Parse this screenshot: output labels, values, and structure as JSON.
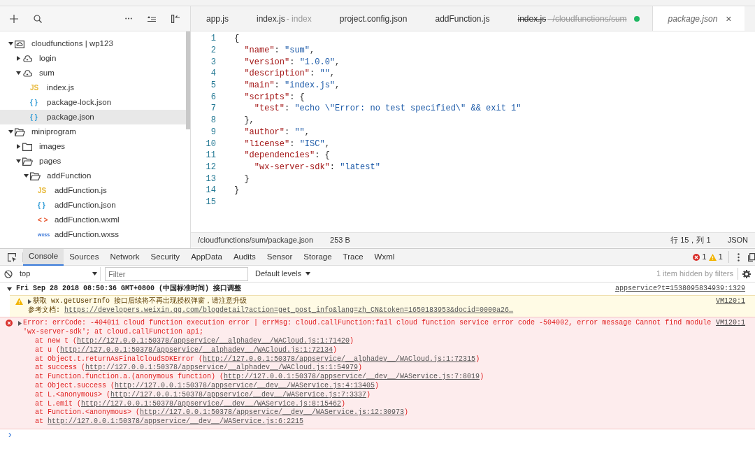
{
  "file_tree": [
    {
      "name": "cloudfunctions | wp123",
      "kind": "folder-cloud",
      "expanded": true,
      "selected": false,
      "children": [
        {
          "name": "login",
          "kind": "cloud",
          "expanded": false,
          "selected": false
        },
        {
          "name": "sum",
          "kind": "cloud",
          "expanded": true,
          "selected": false,
          "children": [
            {
              "name": "index.js",
              "kind": "js",
              "badge": "JS",
              "selected": false
            },
            {
              "name": "package-lock.json",
              "kind": "json",
              "badge": "{ }",
              "selected": false
            },
            {
              "name": "package.json",
              "kind": "json",
              "badge": "{ }",
              "selected": true
            }
          ]
        }
      ]
    },
    {
      "name": "miniprogram",
      "kind": "folder",
      "expanded": true,
      "selected": false,
      "children": [
        {
          "name": "images",
          "kind": "folder",
          "expanded": false,
          "selected": false
        },
        {
          "name": "pages",
          "kind": "folder",
          "expanded": true,
          "selected": false,
          "children": [
            {
              "name": "addFunction",
              "kind": "folder",
              "expanded": true,
              "selected": false,
              "children": [
                {
                  "name": "addFunction.js",
                  "kind": "js",
                  "badge": "JS",
                  "selected": false
                },
                {
                  "name": "addFunction.json",
                  "kind": "json",
                  "badge": "{ }",
                  "selected": false
                },
                {
                  "name": "addFunction.wxml",
                  "kind": "wxml",
                  "badge": "< >",
                  "selected": false
                },
                {
                  "name": "addFunction.wxss",
                  "kind": "wxss",
                  "badge": "wxss",
                  "selected": false
                }
              ]
            }
          ]
        }
      ]
    }
  ],
  "editor_tabs": [
    {
      "name": "app.js",
      "selected": false,
      "deleted": false,
      "modified": false,
      "preview": false
    },
    {
      "name": "index.js",
      "detail": " - index",
      "selected": false,
      "deleted": false,
      "modified": false,
      "preview": false
    },
    {
      "name": "project.config.json",
      "selected": false,
      "deleted": false,
      "modified": false,
      "preview": false
    },
    {
      "name": "addFunction.js",
      "selected": false,
      "deleted": false,
      "modified": false,
      "preview": false
    },
    {
      "name": "index.js",
      "detail": " - /cloudfunctions/sum",
      "selected": false,
      "deleted": true,
      "modified": true,
      "preview": false
    },
    {
      "name": "package.json",
      "selected": true,
      "deleted": false,
      "modified": false,
      "preview": true,
      "close": "×"
    }
  ],
  "code_lines": [
    {
      "number": "1",
      "tokens": [
        {
          "kind": "punct",
          "text": "{"
        }
      ]
    },
    {
      "number": "2",
      "tokens": [
        {
          "kind": "key",
          "text": "  \"name\""
        },
        {
          "kind": "punct",
          "text": ": "
        },
        {
          "kind": "string",
          "text": "\"sum\""
        },
        {
          "kind": "punct",
          "text": ","
        }
      ]
    },
    {
      "number": "3",
      "tokens": [
        {
          "kind": "key",
          "text": "  \"version\""
        },
        {
          "kind": "punct",
          "text": ": "
        },
        {
          "kind": "string",
          "text": "\"1.0.0\""
        },
        {
          "kind": "punct",
          "text": ","
        }
      ]
    },
    {
      "number": "4",
      "tokens": [
        {
          "kind": "key",
          "text": "  \"description\""
        },
        {
          "kind": "punct",
          "text": ": "
        },
        {
          "kind": "string",
          "text": "\"\""
        },
        {
          "kind": "punct",
          "text": ","
        }
      ]
    },
    {
      "number": "5",
      "tokens": [
        {
          "kind": "key",
          "text": "  \"main\""
        },
        {
          "kind": "punct",
          "text": ": "
        },
        {
          "kind": "string",
          "text": "\"index.js\""
        },
        {
          "kind": "punct",
          "text": ","
        }
      ]
    },
    {
      "number": "6",
      "tokens": [
        {
          "kind": "key",
          "text": "  \"scripts\""
        },
        {
          "kind": "punct",
          "text": ": {"
        }
      ]
    },
    {
      "number": "7",
      "tokens": [
        {
          "kind": "key",
          "text": "    \"test\""
        },
        {
          "kind": "punct",
          "text": ": "
        },
        {
          "kind": "string",
          "text": "\"echo \\\"Error: no test specified\\\" && exit 1\""
        }
      ]
    },
    {
      "number": "8",
      "tokens": [
        {
          "kind": "punct",
          "text": "  },"
        }
      ]
    },
    {
      "number": "9",
      "tokens": [
        {
          "kind": "key",
          "text": "  \"author\""
        },
        {
          "kind": "punct",
          "text": ": "
        },
        {
          "kind": "string",
          "text": "\"\""
        },
        {
          "kind": "punct",
          "text": ","
        }
      ]
    },
    {
      "number": "10",
      "tokens": [
        {
          "kind": "key",
          "text": "  \"license\""
        },
        {
          "kind": "punct",
          "text": ": "
        },
        {
          "kind": "string",
          "text": "\"ISC\""
        },
        {
          "kind": "punct",
          "text": ","
        }
      ]
    },
    {
      "number": "11",
      "tokens": [
        {
          "kind": "key",
          "text": "  \"dependencies\""
        },
        {
          "kind": "punct",
          "text": ": {"
        }
      ]
    },
    {
      "number": "12",
      "tokens": [
        {
          "kind": "key",
          "text": "    \"wx-server-sdk\""
        },
        {
          "kind": "punct",
          "text": ": "
        },
        {
          "kind": "string",
          "text": "\"latest\""
        }
      ]
    },
    {
      "number": "13",
      "tokens": [
        {
          "kind": "punct",
          "text": "  }"
        }
      ]
    },
    {
      "number": "14",
      "tokens": [
        {
          "kind": "punct",
          "text": "}"
        }
      ]
    },
    {
      "number": "15"
    }
  ],
  "status_bar": {
    "path": "/cloudfunctions/sum/package.json",
    "size": "253 B",
    "cursor": "行 15，列 1",
    "language": "JSON"
  },
  "devtools_tabs": [
    {
      "label": "Console",
      "selected": true
    },
    {
      "label": "Sources",
      "selected": false
    },
    {
      "label": "Network",
      "selected": false
    },
    {
      "label": "Security",
      "selected": false
    },
    {
      "label": "AppData",
      "selected": false
    },
    {
      "label": "Audits",
      "selected": false
    },
    {
      "label": "Sensor",
      "selected": false
    },
    {
      "label": "Storage",
      "selected": false
    },
    {
      "label": "Trace",
      "selected": false
    },
    {
      "label": "Wxml",
      "selected": false
    }
  ],
  "error_count": "1",
  "warning_count": "1",
  "console_toolbar": {
    "context": "top",
    "filter_placeholder": "Filter",
    "levels": "Default levels",
    "hidden_note": "1 item hidden by filters"
  },
  "console": {
    "group": {
      "title": "Fri Sep 28 2018 08:50:36 GMT+0800 (中国标准时间) 接口调整",
      "source": "appservice?t=1538095834939:1329",
      "expanded": true
    },
    "messages": [
      {
        "kind": "warning",
        "text": "获取 wx.getUserInfo 接口后续将不再出现授权弹窗，请注意升级",
        "source": "VM120:1",
        "lines": [
          {
            "prefix": "参考文档: ",
            "link": "https://developers.weixin.qq.com/blogdetail?action=get_post_info&lang=zh_CN&token=1650183953&docid=0000a26…"
          }
        ]
      },
      {
        "kind": "error",
        "text": "Error: errCode: -404011 cloud function execution error | errMsg: cloud.callFunction:fail cloud function service error code -504002, error message Cannot find module 'wx-server-sdk'; at cloud.callFunction api;",
        "source": "VM120:1",
        "lines": [
          {
            "prefix": "    at new t (",
            "link": "http://127.0.0.1:50378/appservice/__alphadev__/WACloud.js:1:71420",
            "suffix": ")"
          },
          {
            "prefix": "    at u (",
            "link": "http://127.0.0.1:50378/appservice/__alphadev__/WACloud.js:1:72134",
            "suffix": ")"
          },
          {
            "prefix": "    at Object.t.returnAsFinalCloudSDKError (",
            "link": "http://127.0.0.1:50378/appservice/__alphadev__/WACloud.js:1:72315",
            "suffix": ")"
          },
          {
            "prefix": "    at success (",
            "link": "http://127.0.0.1:50378/appservice/__alphadev__/WACloud.js:1:54979",
            "suffix": ")"
          },
          {
            "prefix": "    at Function.function.a.(anonymous function) (",
            "link": "http://127.0.0.1:50378/appservice/__dev__/WAService.js:7:8019",
            "suffix": ")"
          },
          {
            "prefix": "    at Object.success (",
            "link": "http://127.0.0.1:50378/appservice/__dev__/WAService.js:4:13405",
            "suffix": ")"
          },
          {
            "prefix": "    at L.<anonymous> (",
            "link": "http://127.0.0.1:50378/appservice/__dev__/WAService.js:7:3337",
            "suffix": ")"
          },
          {
            "prefix": "    at L.emit (",
            "link": "http://127.0.0.1:50378/appservice/__dev__/WAService.js:8:15462",
            "suffix": ")"
          },
          {
            "prefix": "    at Function.<anonymous> (",
            "link": "http://127.0.0.1:50378/appservice/__dev__/WAService.js:12:30973",
            "suffix": ")"
          },
          {
            "prefix": "    at ",
            "link": "http://127.0.0.1:50378/appservice/__dev__/WAService.js:6:2215"
          }
        ]
      }
    ],
    "prompt": "›"
  }
}
